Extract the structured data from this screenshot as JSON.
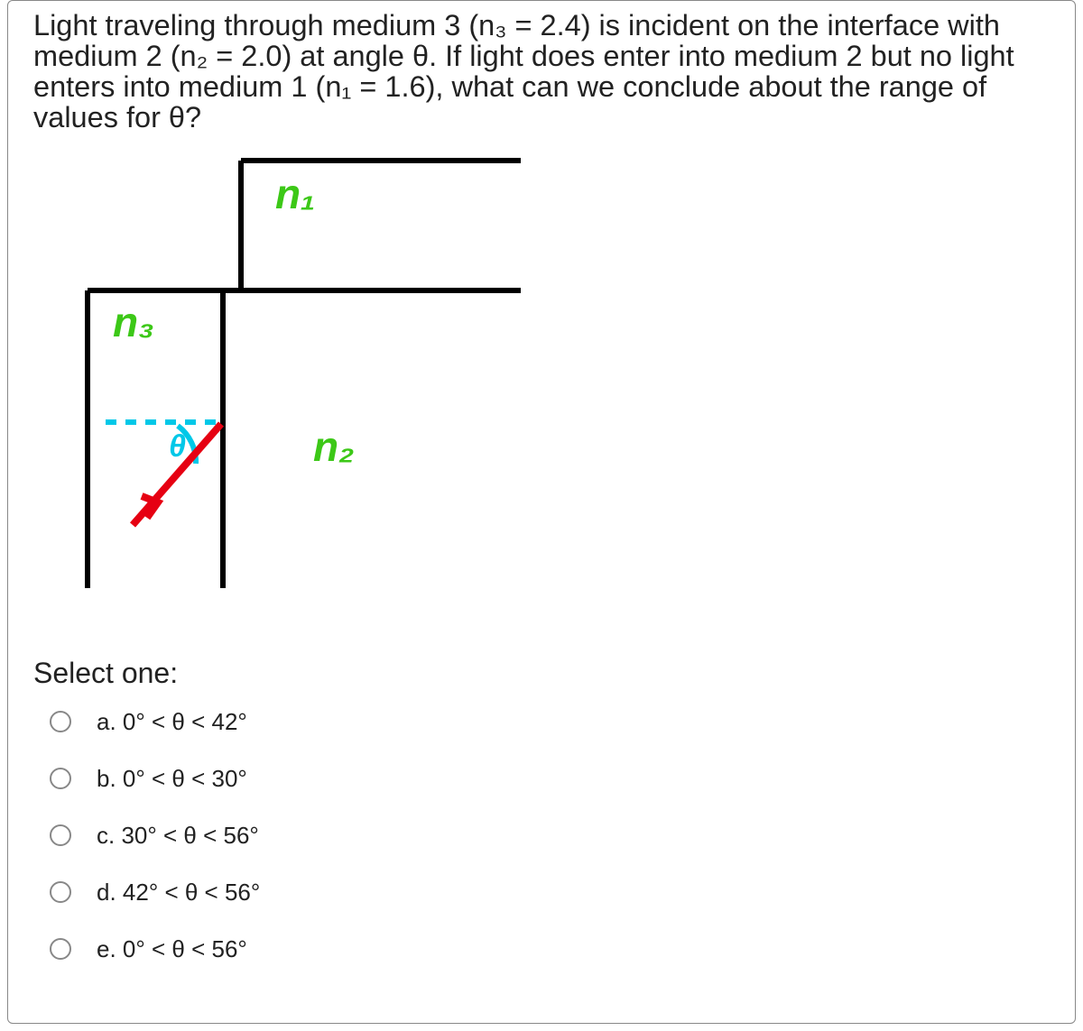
{
  "question": "Light traveling through medium 3 (n₃ = 2.4) is incident on the interface with medium 2 (n₂ = 2.0) at angle θ. If light does enter into medium 2 but no light enters into medium 1 (n₁ = 1.6), what can we conclude about the range of values for θ?",
  "labels": {
    "n1": "n₁",
    "n2": "n₂",
    "n3": "n₃",
    "theta": "θ"
  },
  "select_prompt": "Select one:",
  "options": [
    {
      "key": "a",
      "text": "a. 0° < θ < 42°"
    },
    {
      "key": "b",
      "text": "b. 0° < θ < 30°"
    },
    {
      "key": "c",
      "text": "c. 30° < θ < 56°"
    },
    {
      "key": "d",
      "text": "d. 42° < θ < 56°"
    },
    {
      "key": "e",
      "text": "e. 0° < θ < 56°"
    }
  ]
}
